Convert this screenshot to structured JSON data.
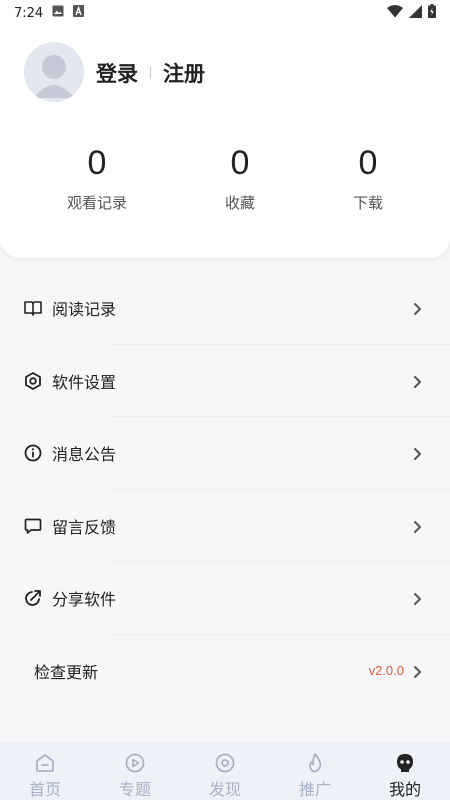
{
  "status_bar": {
    "time": "7:24",
    "icons": [
      "image-icon",
      "font-a-icon",
      "wifi-icon",
      "signal-icon",
      "battery-icon"
    ]
  },
  "profile": {
    "login_label": "登录",
    "register_label": "注册",
    "stats": [
      {
        "value": "0",
        "label": "观看记录"
      },
      {
        "value": "0",
        "label": "收藏"
      },
      {
        "value": "0",
        "label": "下载"
      }
    ]
  },
  "menu": {
    "items": [
      {
        "label": "阅读记录",
        "icon": "book-icon"
      },
      {
        "label": "软件设置",
        "icon": "settings-hexagon-icon"
      },
      {
        "label": "消息公告",
        "icon": "info-icon"
      },
      {
        "label": "留言反馈",
        "icon": "message-icon"
      },
      {
        "label": "分享软件",
        "icon": "share-icon"
      },
      {
        "label": "检查更新",
        "version": "v2.0.0"
      }
    ]
  },
  "bottom_nav": {
    "items": [
      {
        "label": "首页",
        "icon": "home-icon"
      },
      {
        "label": "专题",
        "icon": "play-circle-icon"
      },
      {
        "label": "发现",
        "icon": "discover-icon"
      },
      {
        "label": "推广",
        "icon": "flame-icon"
      },
      {
        "label": "我的",
        "icon": "profile-face-icon"
      }
    ],
    "active_index": 4
  },
  "colors": {
    "accent_version": "#e05a3a",
    "nav_inactive": "#a8b0c4",
    "nav_active": "#222222"
  }
}
